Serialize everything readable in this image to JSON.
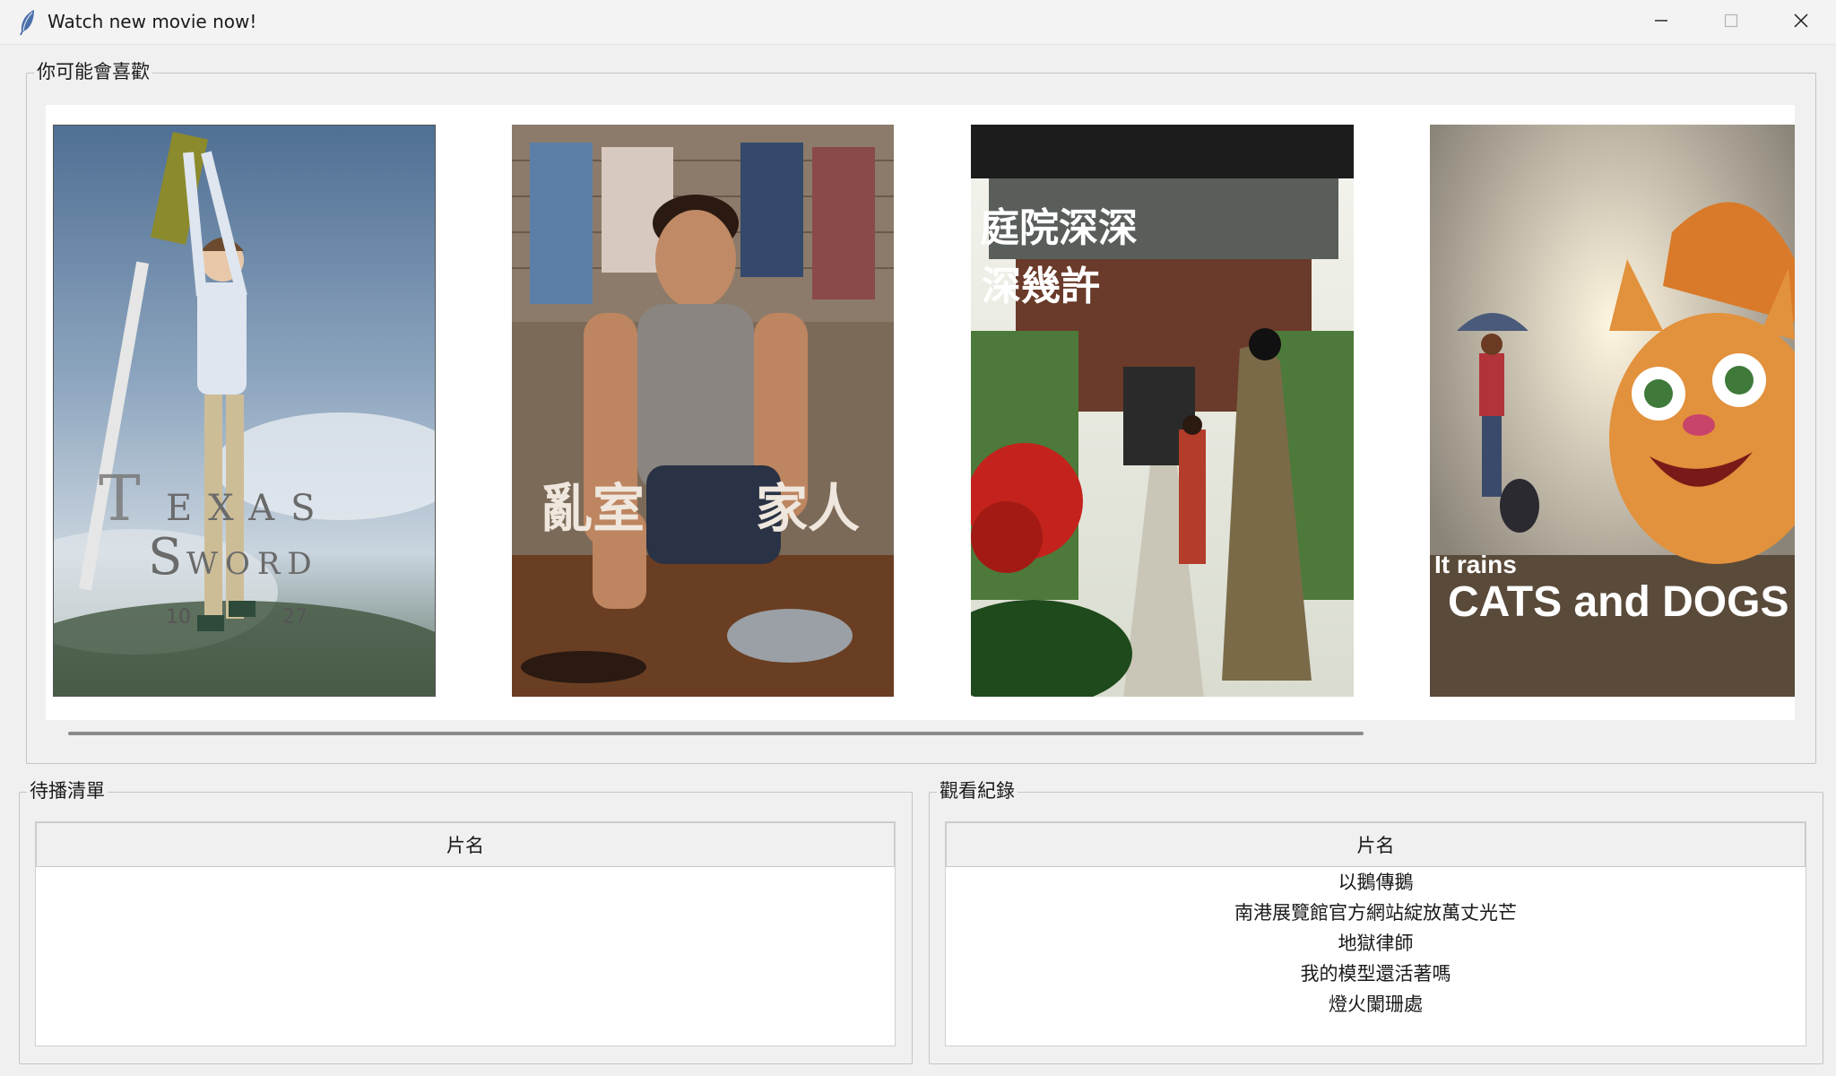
{
  "window": {
    "title": "Watch new movie now!",
    "icons": {
      "app": "feather-icon",
      "minimize": "minimize-icon",
      "maximize": "maximize-icon",
      "close": "close-icon"
    }
  },
  "recommend": {
    "label": "你可能會喜歡",
    "posters": [
      {
        "name": "poster-texas-sword",
        "lines": [
          "TEXAS",
          "SWORD",
          "10  27"
        ]
      },
      {
        "name": "poster-messy-room",
        "lines": [
          "亂室",
          "家人"
        ]
      },
      {
        "name": "poster-courtyard",
        "lines": [
          "庭院深深",
          "深幾許"
        ]
      },
      {
        "name": "poster-cats-dogs",
        "lines": [
          "It rains",
          "CATS and DOGS"
        ]
      }
    ]
  },
  "queue": {
    "label": "待播清單",
    "column": "片名",
    "rows": []
  },
  "history": {
    "label": "觀看紀錄",
    "column": "片名",
    "rows": [
      "以鵝傳鵝",
      "南港展覽館官方網站綻放萬丈光芒",
      "地獄律師",
      "我的模型還活著嗎",
      "燈火闌珊處"
    ]
  },
  "colors": {
    "window_bg": "#f0f0f0",
    "canvas_bg": "#ffffff",
    "frame_border": "#c4c4c4",
    "scrollbar": "#8a8a8a"
  }
}
